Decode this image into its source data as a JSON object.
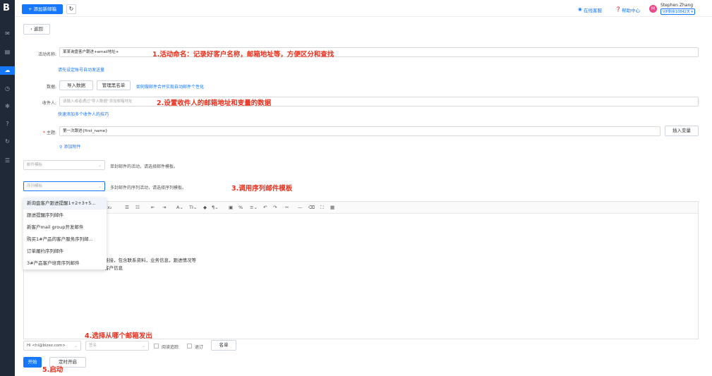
{
  "sidebar": {
    "logo": "B"
  },
  "topbar": {
    "add_button": "+ 添加新邮箱",
    "online_service": "在线客服",
    "help_center": "帮助中心",
    "avatar_letter": "M",
    "user_name": "Stephen Zhang",
    "user_plan": "VIP剩余10842天 ▾"
  },
  "back_button": "返回",
  "form": {
    "activity_label": "活动名称:",
    "activity_value": "某某询盘客户跟进+email地址+",
    "set_account_link": "请先设定账号自动发送量",
    "data_label": "数据:",
    "import_button": "导入数据",
    "blacklist_button": "管理黑名单",
    "personalize_link": "如何做邮件合并实现自动邮件个性化",
    "recipient_label": "收件人:",
    "recipient_placeholder": "请输入或者通过\"导入数据\"添加邮箱地址",
    "multi_recipient_link": "快速添加多个收件人的技巧",
    "subject_label": "主题:",
    "subject_value": "第一次跟进{first_name}",
    "insert_var_button": "插入变量",
    "attachment_link": "添加附件",
    "single_template_placeholder": "邮件模板",
    "single_template_note": "单封邮件的活动，请选择邮件模板。",
    "seq_template_placeholder": "序列模板",
    "seq_template_note": "多封邮件的序列活动，请选择序列模板。"
  },
  "dropdown_items": [
    "新询盘客户跟进提醒1+2+3+5...",
    "跟进提醒序列邮件",
    "新客户mail group开发邮件",
    "购买1#产品的客户服务序列邮...",
    "订单履约序列邮件",
    "3#产品客户培育序列邮件"
  ],
  "editor": {
    "line1": "链接，包含联系资料，业务信息，跟进情况等",
    "line2": "客户信息"
  },
  "footer": {
    "sender_value": "Hi <hi@bizez.com>",
    "signature_placeholder": "签名",
    "read_receipt": "阅读追踪",
    "unsubscribe": "退订",
    "list_button": "名单",
    "start_button": "开始",
    "schedule_button": "定时开启"
  },
  "annotations": {
    "a1": "1.活动命名：记录好客户名称，邮箱地址等，方便区分和查找",
    "a2": "2.设置收件人的邮箱地址和变量的数据",
    "a3": "3.调用序列邮件模板",
    "a4": "4.选择从哪个邮箱发出",
    "a5": "5.启动"
  }
}
